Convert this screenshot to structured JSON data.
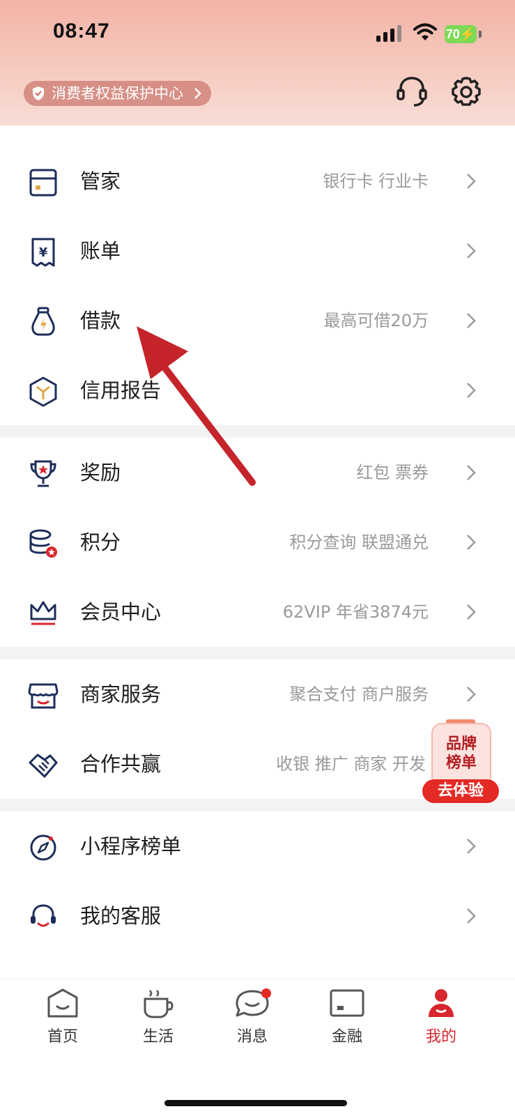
{
  "status_bar": {
    "time": "08:47",
    "battery": "70"
  },
  "header": {
    "protection_link": "消费者权益保护中心"
  },
  "sections": [
    {
      "rows": [
        {
          "label": "管家",
          "sub": "银行卡 行业卡"
        },
        {
          "label": "账单",
          "sub": ""
        },
        {
          "label": "借款",
          "sub": "最高可借20万"
        },
        {
          "label": "信用报告",
          "sub": ""
        }
      ]
    },
    {
      "rows": [
        {
          "label": "奖励",
          "sub": "红包 票券"
        },
        {
          "label": "积分",
          "sub": "积分查询 联盟通兑"
        },
        {
          "label": "会员中心",
          "sub": "62VIP 年省3874元"
        }
      ]
    },
    {
      "rows": [
        {
          "label": "商家服务",
          "sub": "聚合支付 商户服务"
        },
        {
          "label": "合作共赢",
          "sub": "收银 推广 商家 开发"
        }
      ]
    },
    {
      "rows": [
        {
          "label": "小程序榜单",
          "sub": ""
        },
        {
          "label": "我的客服",
          "sub": ""
        }
      ]
    }
  ],
  "float_badge": {
    "line1": "品牌",
    "line2": "榜单",
    "cta": "去体验"
  },
  "tabbar": [
    {
      "label": "首页"
    },
    {
      "label": "生活"
    },
    {
      "label": "消息"
    },
    {
      "label": "金融"
    },
    {
      "label": "我的"
    }
  ],
  "colors": {
    "accent": "#d8262e",
    "icon_blue": "#1d2d5a",
    "header_pink": "#f3b3a6"
  }
}
